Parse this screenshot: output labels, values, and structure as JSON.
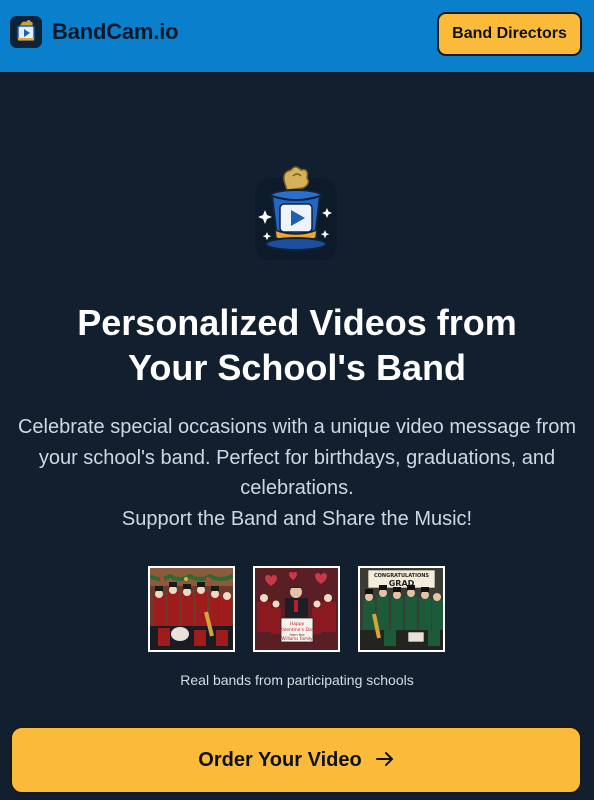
{
  "header": {
    "brand_name": "BandCam.io",
    "cta_label": "Band Directors"
  },
  "hero": {
    "headline_line1": "Personalized Videos from",
    "headline_line2": "Your School's Band",
    "description": "Celebrate special occasions with a unique video message from your school's band. Perfect for birthdays, graduations, and celebrations.",
    "tagline": "Support the Band and Share the Music!"
  },
  "gallery": {
    "thumbnails": [
      {
        "name": "christmas-band-photo",
        "text": ""
      },
      {
        "name": "valentines-band-photo",
        "text": "Happy Valentine's Day from the Williams Family"
      },
      {
        "name": "graduation-band-photo",
        "text": "CONGRATULATIONS GRAD"
      }
    ],
    "caption": "Real bands from participating schools"
  },
  "order": {
    "label": "Order Your Video",
    "arrow_icon": "arrow-right-icon"
  },
  "colors": {
    "header_bg": "#0a7fcc",
    "page_bg": "#111f2e",
    "button_yellow": "#fbbb3a"
  }
}
